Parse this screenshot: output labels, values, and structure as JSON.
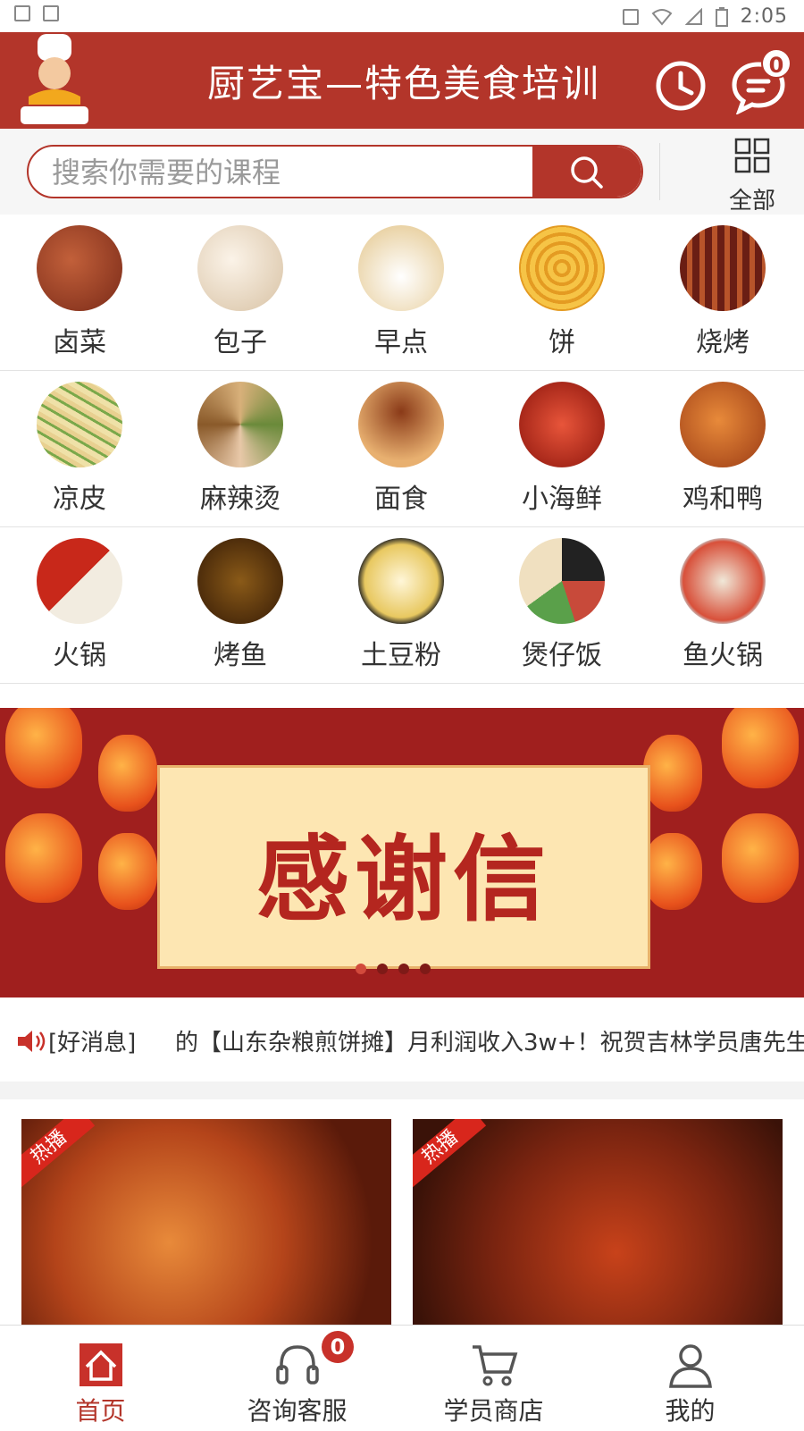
{
  "status_bar": {
    "time": "2:05"
  },
  "header": {
    "logo_text": "厨艺宝",
    "title": "厨艺宝—特色美食培训",
    "message_badge": "0"
  },
  "search": {
    "placeholder": "搜索你需要的课程",
    "all_label": "全部"
  },
  "categories": [
    {
      "label": "卤菜",
      "color": "#8a3a22"
    },
    {
      "label": "包子",
      "color": "#e9d7c0"
    },
    {
      "label": "早点",
      "color": "#e7d4a8"
    },
    {
      "label": "饼",
      "color": "#f2b43a"
    },
    {
      "label": "烧烤",
      "color": "#7a2a1c"
    },
    {
      "label": "凉皮",
      "color": "#e8d9a0"
    },
    {
      "label": "麻辣烫",
      "color": "#8c6a3a"
    },
    {
      "label": "面食",
      "color": "#a05a2a"
    },
    {
      "label": "小海鲜",
      "color": "#c5412a"
    },
    {
      "label": "鸡和鸭",
      "color": "#b85a1c"
    },
    {
      "label": "火锅",
      "color": "#b62a1e"
    },
    {
      "label": "烤鱼",
      "color": "#6a3a12"
    },
    {
      "label": "土豆粉",
      "color": "#e8d070"
    },
    {
      "label": "煲仔饭",
      "color": "#5a4a3a"
    },
    {
      "label": "鱼火锅",
      "color": "#d0503a"
    }
  ],
  "banner": {
    "text": "感谢信",
    "dots": 4,
    "active_dot": 0
  },
  "news": {
    "tag": "[好消息]",
    "text": "的【山东杂粮煎饼摊】月利润收入3w+！祝贺吉林学员唐先生"
  },
  "feed": [
    {
      "tag": "热播"
    },
    {
      "tag": "热播"
    }
  ],
  "tabbar": {
    "items": [
      {
        "label": "首页",
        "icon": "home-icon"
      },
      {
        "label": "咨询客服",
        "icon": "headset-icon",
        "badge": "0"
      },
      {
        "label": "学员商店",
        "icon": "cart-icon"
      },
      {
        "label": "我的",
        "icon": "user-icon"
      }
    ]
  },
  "colors": {
    "brand": "#b3352a",
    "banner_bg": "#a01f1e"
  }
}
